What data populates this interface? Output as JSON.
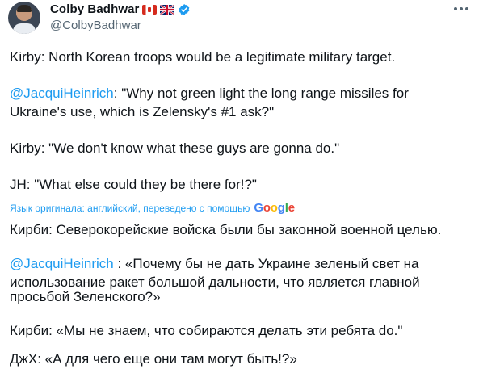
{
  "author": {
    "display_name": "Colby Badhwar",
    "handle": "@ColbyBadhwar",
    "flags": [
      "canada-flag-icon",
      "uk-flag-icon"
    ],
    "verified": true
  },
  "original": {
    "line1": "Kirby: North Korean troops would be a legitimate military target.",
    "p2_mention": "@JacquiHeinrich",
    "p2_line1_rest": ": \"Why not green light the long range missiles for",
    "p2_line2": "Ukraine's use, which is Zelensky's #1 ask?\"",
    "p3": "Kirby: \"We don't know what these guys are gonna do.\"",
    "p4": "JH: \"What else could they be there for!?\""
  },
  "translation": {
    "notice": "Язык оригинала: английский, переведено с помощью",
    "provider": "Google",
    "p1": "Кирби: Северокорейские войска были бы законной военной целью.",
    "p2_mention": "@JacquiHeinrich",
    "p2_line1_rest": " : «Почему бы не дать Украине зеленый свет на",
    "p2_line2": "использование ракет большой дальности, что является главной",
    "p2_line3": "просьбой Зеленского?»",
    "p3": "Кирби: «Мы не знаем, что собираются делать эти ребята do.\"",
    "p4": "ДжХ: «А для чего еще они там могут быть!?»"
  },
  "colors": {
    "link": "#1d9bf0",
    "secondary_text": "#536471",
    "primary_text": "#0f1419"
  }
}
